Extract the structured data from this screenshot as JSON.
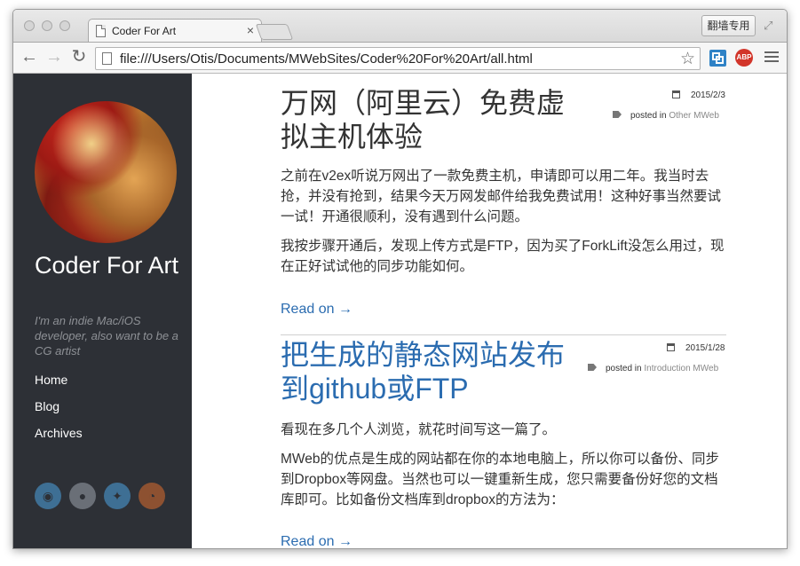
{
  "browser": {
    "tab_title": "Coder For Art",
    "tab_close": "×",
    "ext_button": "翻墙专用",
    "url": "file:///Users/Otis/Documents/MWebSites/Coder%20For%20Art/all.html",
    "back_icon": "←",
    "forward_icon": "→",
    "reload_icon": "↻",
    "star_icon": "☆",
    "abp_label": "ABP",
    "fullscreen_icon": "⤢"
  },
  "sidebar": {
    "site_title": "Coder For Art",
    "tagline": "I'm an indie Mac/iOS developer, also want to be a CG artist",
    "nav": [
      "Home",
      "Blog",
      "Archives"
    ],
    "social_icons": [
      "weibo-icon",
      "github-icon",
      "twitter-icon",
      "rss-icon"
    ],
    "bg_color": "#2d3036"
  },
  "posts": [
    {
      "title": "万网（阿里云）免费虚拟主机体验",
      "date": "2015/2/3",
      "posted_in": "posted in",
      "tags": [
        "Other",
        "MWeb"
      ],
      "paragraphs": [
        "之前在v2ex听说万网出了一款免费主机，申请即可以用二年。我当时去抢，并没有抢到，结果今天万网发邮件给我免费试用！这种好事当然要试一试！开通很顺利，没有遇到什么问题。",
        "我按步骤开通后，发现上传方式是FTP，因为买了ForkLift没怎么用过，现在正好试试他的同步功能如何。"
      ],
      "read_on": "Read on →"
    },
    {
      "title": "把生成的静态网站发布到github或FTP",
      "date": "2015/1/28",
      "posted_in": "posted in",
      "tags": [
        "Introduction",
        "MWeb"
      ],
      "paragraphs": [
        "看现在多几个人浏览，就花时间写这一篇了。",
        "MWeb的优点是生成的网站都在你的本地电脑上，所以你可以备份、同步到Dropbox等网盘。当然也可以一键重新生成，您只需要备份好您的文档库即可。比如备份文档库到dropbox的方法为："
      ],
      "read_on": "Read on →"
    }
  ],
  "colors": {
    "link": "#2b6cb0",
    "text": "#333333"
  }
}
